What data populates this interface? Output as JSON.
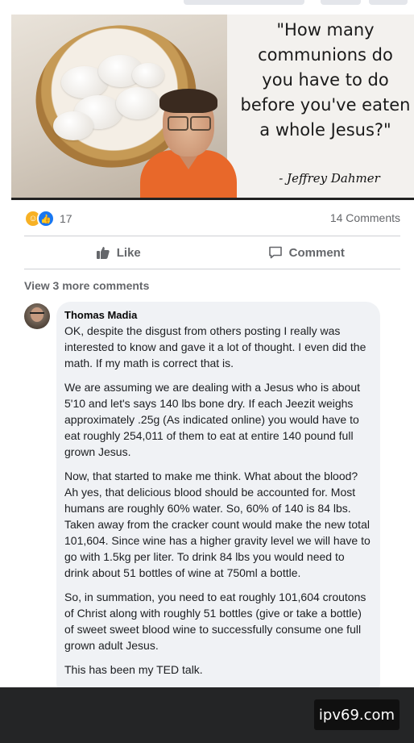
{
  "meme": {
    "quote": "\"How many communions do you have to do before you've eaten a whole Jesus?\"",
    "signature": "- Jeffrey Dahmer"
  },
  "post": {
    "reaction_count": "17",
    "comment_count": "14 Comments",
    "like_label": "Like",
    "comment_label": "Comment",
    "view_more": "View 3 more comments"
  },
  "comment": {
    "author": "Thomas Madia",
    "paragraphs": [
      "OK, despite the disgust from others posting I really was interested to know and gave it a lot of thought. I even did the math. If my math is correct that is.",
      "We are assuming we are dealing with a Jesus who is about 5'10 and let's says 140 lbs bone dry. If each Jeezit weighs approximately .25g (As indicated online) you would have to eat roughly 254,011 of them to eat at entire 140 pound full grown Jesus.",
      "Now, that started to make me think. What about the blood? Ah yes, that delicious blood should be accounted for. Most humans are roughly 60% water. So, 60% of 140 is 84 lbs. Taken away from the cracker count would make the new total 101,604. Since wine has a higher gravity level we will have to go with 1.5kg per liter. To drink 84 lbs you would need to drink about 51 bottles of wine at 750ml a bottle.",
      "So, in summation, you need to eat roughly 101,604 croutons of Christ along with roughly 51 bottles (give or take a bottle) of sweet sweet blood wine to successfully consume one full grown adult Jesus.",
      "This has been my TED talk."
    ]
  },
  "watermark": "ipv69.com",
  "colors": {
    "haha": "#f7b125",
    "like": "#1877f2",
    "bubble": "#f0f2f5",
    "bottom_bar": "#242526"
  }
}
